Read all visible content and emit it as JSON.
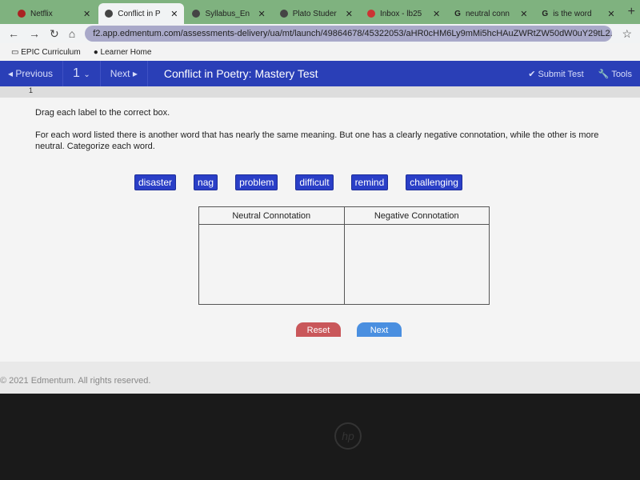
{
  "browser": {
    "tabs": [
      {
        "label": "Netflix"
      },
      {
        "label": "Conflict in P"
      },
      {
        "label": "Syllabus_En"
      },
      {
        "label": "Plato Studer"
      },
      {
        "label": "Inbox - lb25"
      },
      {
        "label": "neutral conn"
      },
      {
        "label": "is the word"
      }
    ],
    "url": "f2.app.edmentum.com/assessments-delivery/ua/mt/launch/49864678/45322053/aHR0cHM6Ly9mMi5hcHAuZWRtZW50dW0uY29tL2...",
    "bookmarks": [
      "EPIC Curriculum",
      "Learner Home"
    ]
  },
  "nav": {
    "previous": "Previous",
    "question_number": "1",
    "next": "Next",
    "title": "Conflict in Poetry: Mastery Test",
    "submit": "Submit Test",
    "tools": "Tools"
  },
  "question": {
    "number": "1",
    "instruction": "Drag each label to the correct box.",
    "prompt": "For each word listed there is another word that has nearly the same meaning. But one has a clearly negative connotation, while the other is more neutral. Categorize each word.",
    "labels": [
      "disaster",
      "nag",
      "problem",
      "difficult",
      "remind",
      "challenging"
    ],
    "columns": [
      "Neutral Connotation",
      "Negative Connotation"
    ],
    "reset": "Reset",
    "next": "Next"
  },
  "footer": "© 2021 Edmentum. All rights reserved.",
  "device_logo": "hp"
}
